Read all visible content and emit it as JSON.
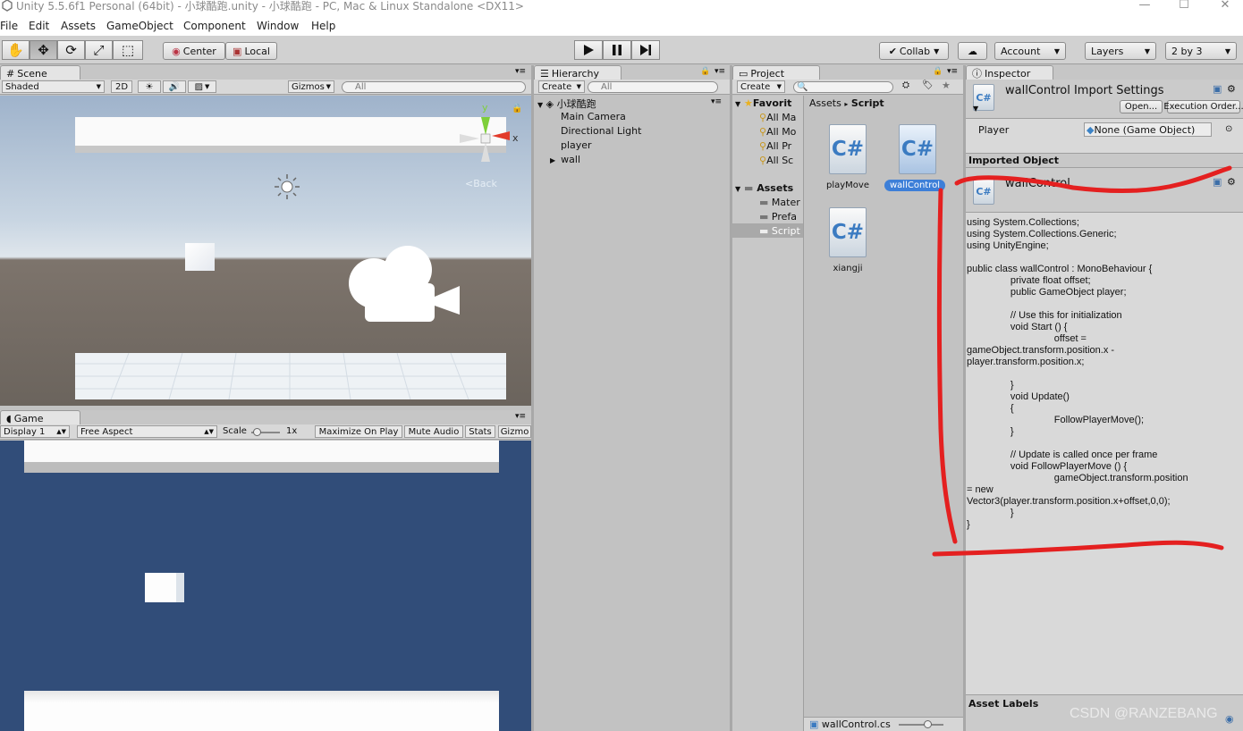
{
  "window": {
    "title": "Unity 5.5.6f1 Personal (64bit) - 小球酷跑.unity - 小球酷跑 - PC, Mac & Linux Standalone <DX11>",
    "minimize": "—",
    "maximize": "☐",
    "close": "✕"
  },
  "menu": [
    "File",
    "Edit",
    "Assets",
    "GameObject",
    "Component",
    "Window",
    "Help"
  ],
  "toolbar": {
    "center_label": "Center",
    "local_label": "Local",
    "collab_label": "Collab",
    "account_label": "Account",
    "layers_label": "Layers",
    "layout_label": "2 by 3"
  },
  "scene": {
    "tab_label": "Scene",
    "shade_mode": "Shaded",
    "mode_2d": "2D",
    "gizmos_label": "Gizmos",
    "search_placeholder": "All",
    "gizmo_y": "y",
    "gizmo_x": "x",
    "back_label": "Back"
  },
  "game": {
    "tab_label": "Game",
    "display": "Display 1",
    "aspect": "Free Aspect",
    "scale_label": "Scale",
    "scale_value": "1x",
    "maximize_label": "Maximize On Play",
    "mute_label": "Mute Audio",
    "stats_label": "Stats",
    "gizmos_label": "Gizmo"
  },
  "hierarchy": {
    "tab_label": "Hierarchy",
    "create_label": "Create",
    "search_placeholder": "All",
    "scene_name": "小球酷跑",
    "items": [
      "Main Camera",
      "Directional Light",
      "player",
      "wall"
    ]
  },
  "project": {
    "tab_label": "Project",
    "create_label": "Create",
    "favorites_label": "Favorit",
    "favorites": [
      "All Ma",
      "All Mo",
      "All Pr",
      "All Sc"
    ],
    "assets_label": "Assets",
    "folders": [
      "Mater",
      "Prefa",
      "Script"
    ],
    "breadcrumb_root": "Assets",
    "breadcrumb_sep": "▸",
    "breadcrumb_current": "Script",
    "files": [
      "playMove",
      "wallControl",
      "xiangji"
    ],
    "selected_file": "wallControl.cs"
  },
  "inspector": {
    "tab_label": "Inspector",
    "header_title": "wallControl Import Settings",
    "open_button": "Open...",
    "exec_order_button": "Execution Order...",
    "player_label": "Player",
    "player_value": "None (Game Object)",
    "imported_object_label": "Imported Object",
    "script_name": "wallControl",
    "code": "using System.Collections;\nusing System.Collections.Generic;\nusing UnityEngine;\n\npublic class wallControl : MonoBehaviour {\n\t\tprivate float offset;\n\t\tpublic GameObject player;\n\n\t\t// Use this for initialization\n\t\tvoid Start () {\n\t\t\t\toffset =\ngameObject.transform.position.x -\nplayer.transform.position.x;\n\n\t\t}\n\t\tvoid Update()\n\t\t{\n\t\t\t\tFollowPlayerMove();\n\t\t}\n\n\t\t// Update is called once per frame\n\t\tvoid FollowPlayerMove () {\n\t\t\t\tgameObject.transform.position\n= new\nVector3(player.transform.position.x+offset,0,0);\n\t\t}\n}",
    "asset_labels": "Asset Labels",
    "watermark": "CSDN @RANZEBANG"
  },
  "colors": {
    "accent_selection": "#3d7fd8",
    "scene_ground": "#6f6760",
    "game_bg": "#314d79",
    "annotation_red": "#e42020"
  }
}
